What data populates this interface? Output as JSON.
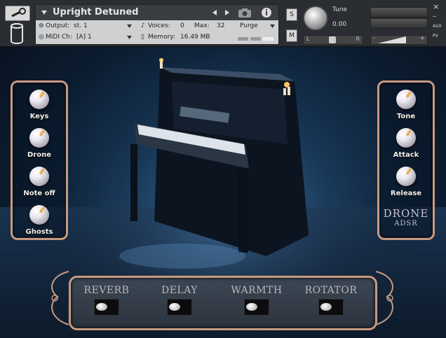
{
  "header": {
    "instrument_name": "Upright Detuned",
    "output_label": "Output:",
    "output_value": "st. 1",
    "voices_label": "Voices:",
    "voices_value": "0",
    "max_label": "Max:",
    "max_value": "32",
    "purge_label": "Purge",
    "midi_label": "MIDI Ch:",
    "midi_value": "[A]  1",
    "memory_label": "Memory:",
    "memory_value": "16.49 MB",
    "solo_label": "S",
    "mute_label": "M",
    "tune_label": "Tune",
    "tune_value": "0.00",
    "pan_left": "L",
    "pan_right": "R",
    "vol_minus": "-",
    "vol_plus": "+",
    "close_label": "×",
    "minimize_label": "–",
    "aux_label": "AUX",
    "pv_label": "PV"
  },
  "left_panel": {
    "knobs": [
      {
        "label": "Keys"
      },
      {
        "label": "Drone"
      },
      {
        "label": "Note off"
      },
      {
        "label": "Ghosts"
      }
    ]
  },
  "right_panel": {
    "knobs": [
      {
        "label": "Tone"
      },
      {
        "label": "Attack"
      },
      {
        "label": "Release"
      }
    ],
    "title": "DRONE",
    "subtitle": "ADSR"
  },
  "fx_panel": {
    "effects": [
      {
        "label": "REVERB"
      },
      {
        "label": "DELAY"
      },
      {
        "label": "WARMTH"
      },
      {
        "label": "ROTATOR"
      }
    ]
  },
  "colors": {
    "panel_border": "#c79a80",
    "header_bg": "#2a2d31",
    "knob_indicator": "#e7b25a"
  }
}
